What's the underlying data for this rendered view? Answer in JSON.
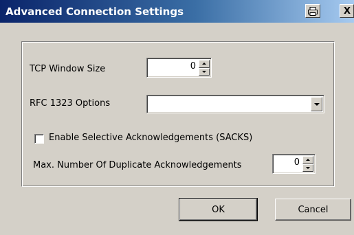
{
  "window": {
    "title": "Advanced Connection Settings",
    "print_icon": "printer-icon",
    "close_label": "X"
  },
  "form": {
    "tcp_window_size": {
      "label": "TCP Window Size",
      "value": "0"
    },
    "rfc1323": {
      "label": "RFC 1323 Options",
      "selected": ""
    },
    "sacks": {
      "label": "Enable Selective Acknowledgements (SACKS)",
      "checked": false
    },
    "max_dup_acks": {
      "label": "Max. Number Of Duplicate Acknowledgements",
      "value": "0"
    }
  },
  "buttons": {
    "ok": "OK",
    "cancel": "Cancel"
  },
  "colors": {
    "face": "#d4d0c8",
    "title_start": "#0a246a",
    "title_end": "#a6caf0"
  }
}
